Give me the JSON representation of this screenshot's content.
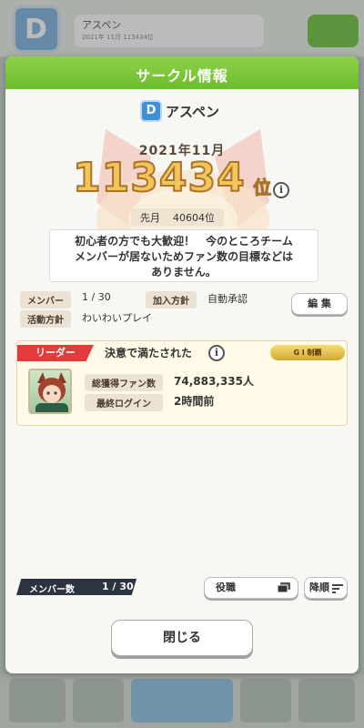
{
  "background": {
    "circle_initial": "D",
    "circle_name": "アスペン",
    "circle_sub": "2021年 11月 113434位"
  },
  "dialog": {
    "title": "サークル情報",
    "circle_initial": "D",
    "circle_name": "アスペン",
    "month": "2021年11月",
    "rank_number": "113434",
    "rank_unit": "位",
    "prev_month_label": "先月",
    "prev_month_rank": "40604位",
    "description_lines": [
      "初心者の方でも大歓迎！　今のところチーム",
      "メンバーが居ないためファン数の目標などは",
      "ありません。"
    ],
    "members_label": "メンバー",
    "members_value": "1 / 30",
    "join_policy_label": "加入方針",
    "join_policy_value": "自動承認",
    "activity_label": "活動方針",
    "activity_value": "わいわいプレイ",
    "edit_button": "編 集",
    "leader": {
      "tag": "リーダー",
      "name": "決意で満たされた",
      "badge": "G I 制覇",
      "total_fans_label": "総獲得ファン数",
      "total_fans_value": "74,883,335人",
      "last_login_label": "最終ログイン",
      "last_login_value": "2時間前"
    },
    "member_count_label": "メンバー数",
    "member_count_value": "1 / 30",
    "sort_field": "役職",
    "sort_order": "降順",
    "close_button": "閉じる"
  },
  "colors": {
    "header_green": "#7cc63a",
    "leader_tag_red": "#e23b3b",
    "rank_gold": "#f3c45a",
    "panel_cream": "#fffbe8"
  }
}
